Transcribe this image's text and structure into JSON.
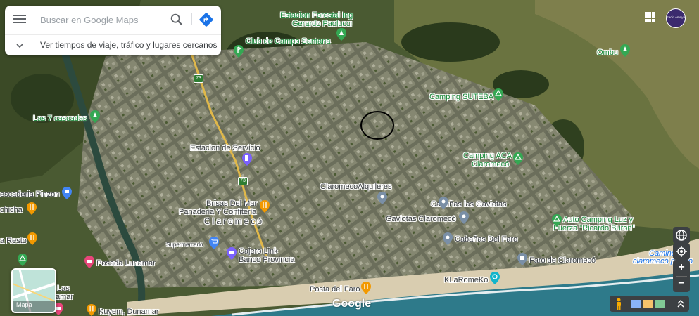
{
  "search": {
    "placeholder": "Buscar en Google Maps",
    "hint": "Ver tiempos de viaje, tráfico y lugares cercanos"
  },
  "map": {
    "labels": {
      "estacion_forestal": "Estacion Forestal Ing",
      "estacion_forestal2": "Gerardo Paolucci",
      "club_campo": "Club de Campo Santana",
      "ombu": "Ombu",
      "camping_suteba": "Camping SUTEBA",
      "siete_cascadas": "Las 7 cascadas",
      "estacion_servicio": "Estacion de Servicio",
      "camping_aca": "Camping ACA",
      "camping_aca2": "Claromecó",
      "pescaderia": "escaderia Pinzon",
      "chicha": "chicha",
      "claromeco_alquileres": "ClaromecoAlquileres",
      "brisas": "Brisas Del Mar",
      "brisas2": "Panaderia Y Confiteria",
      "cabanas_gaviotas": "Cabañas las Gaviotas",
      "town": "Claromecó",
      "gaviotas_claromeco": "Gaviotas Claromecó",
      "auto_camping": "Auto Camping Luz y",
      "auto_camping2": "Fuerza \"Ricardo Buron\"",
      "resto": "a Resto",
      "supermercado": "Supermercado",
      "cajero": "Cajero Link",
      "cajero2": "Banco Provincia",
      "cabanas_faro": "Cabañas Del Faro",
      "camino": "Camino",
      "camino2": "claromecó puerto",
      "posada": "Posada Lunamar",
      "faro": "Faro de Claromecó",
      "las_lunamar": "Las",
      "las_lunamar2": "amar",
      "klaromeko": "KLaRomeKo",
      "posta": "Posta del Faro",
      "kuyem": "Kuyem, Dunamar",
      "route73": "73"
    },
    "layer_label": "Mapa",
    "google": "Google",
    "avatar_text": "Facio Amaya"
  }
}
